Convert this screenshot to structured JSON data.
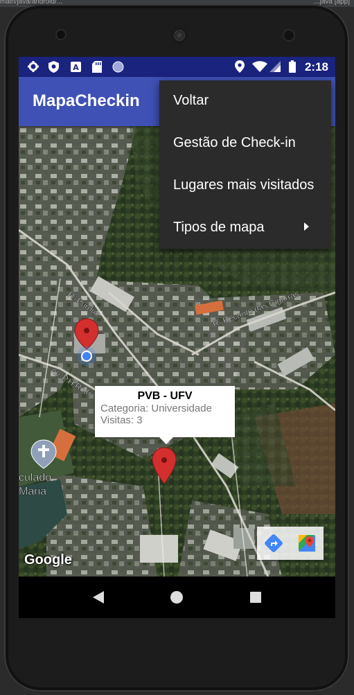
{
  "ide": {
    "left_text": "main/java/android/...",
    "right_text": "...java [app]"
  },
  "statusbar": {
    "time": "2:18",
    "left_icons": [
      "gear-icon",
      "shield-icon",
      "text-a-icon",
      "sd-card-icon",
      "circle-icon"
    ],
    "right_icons": [
      "location-pin-icon",
      "wifi-icon",
      "signal-icon",
      "battery-icon"
    ]
  },
  "appbar": {
    "title": "MapaCheckin"
  },
  "menu": {
    "items": [
      {
        "label": "Voltar"
      },
      {
        "label": "Gestão de Check-in"
      },
      {
        "label": "Lugares mais visitados"
      },
      {
        "label": "Tipos de mapa",
        "submenu": true
      }
    ]
  },
  "map": {
    "streets": [
      "R. Purdue",
      "R. Recanto das Cigarras",
      "Av. P.H.Rolfs"
    ],
    "poi_label_line1": "culado",
    "poi_label_line2": "Maria",
    "google_label": "Google"
  },
  "info_window": {
    "title": "PVB - UFV",
    "category": "Categoria: Universidade",
    "visits": "Visitas: 3"
  },
  "colors": {
    "statusbar": "#1a237e",
    "appbar": "#3f51b5",
    "menu_bg": "#2b2b2b",
    "marker": "#d32f2f",
    "my_location": "#4285f4"
  }
}
